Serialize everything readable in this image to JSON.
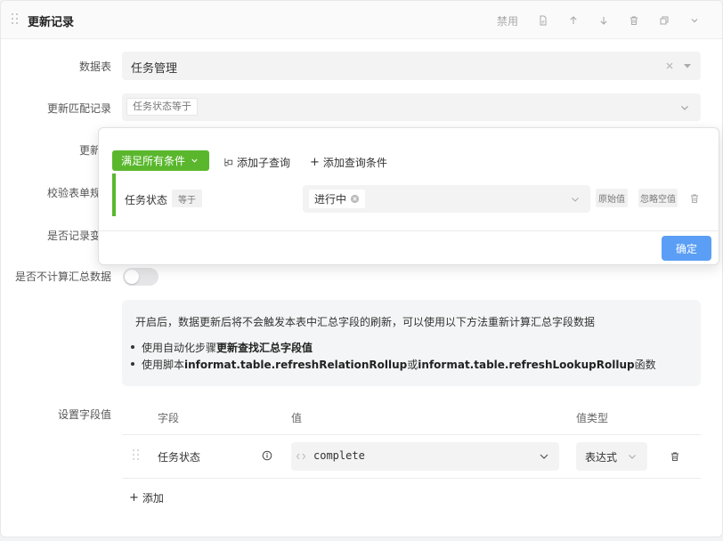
{
  "header": {
    "title": "更新记录",
    "disable_label": "禁用"
  },
  "form": {
    "table_label": "数据表",
    "table_value": "任务管理",
    "match_label": "更新匹配记录",
    "match_tag": "任务状态等于",
    "hidden_label_1": "更新",
    "validate_label": "校验表单规",
    "record_change_label": "是否记录变",
    "no_rollup_label": "是否不计算汇总数据",
    "no_rollup_on": false
  },
  "info": {
    "text": "开启后，数据更新后将不会触发本表中汇总字段的刷新，可以使用以下方法重新计算汇总字段数据",
    "item1_prefix": "使用自动化步骤",
    "item1_bold": "更新查找汇总字段值",
    "item2_prefix": "使用脚本",
    "item2_bold1": "informat.table.refreshRelationRollup",
    "item2_mid": "或",
    "item2_bold2": "informat.table.refreshLookupRollup",
    "item2_suffix": "函数"
  },
  "fields": {
    "label": "设置字段值",
    "col_field": "字段",
    "col_value": "值",
    "col_type": "值类型",
    "rows": [
      {
        "field": "任务状态",
        "value": "complete",
        "type": "表达式"
      }
    ],
    "add_label": "添加"
  },
  "popup": {
    "match_all": "满足所有条件",
    "add_subquery": "添加子查询",
    "add_condition": "添加查询条件",
    "condition": {
      "field": "任务状态",
      "op": "等于",
      "value": "进行中",
      "raw_value": "原始值",
      "ignore_empty": "忽略空值"
    },
    "confirm": "确定"
  },
  "colors": {
    "green": "#5ab72d",
    "blue": "#5a9ef5"
  }
}
